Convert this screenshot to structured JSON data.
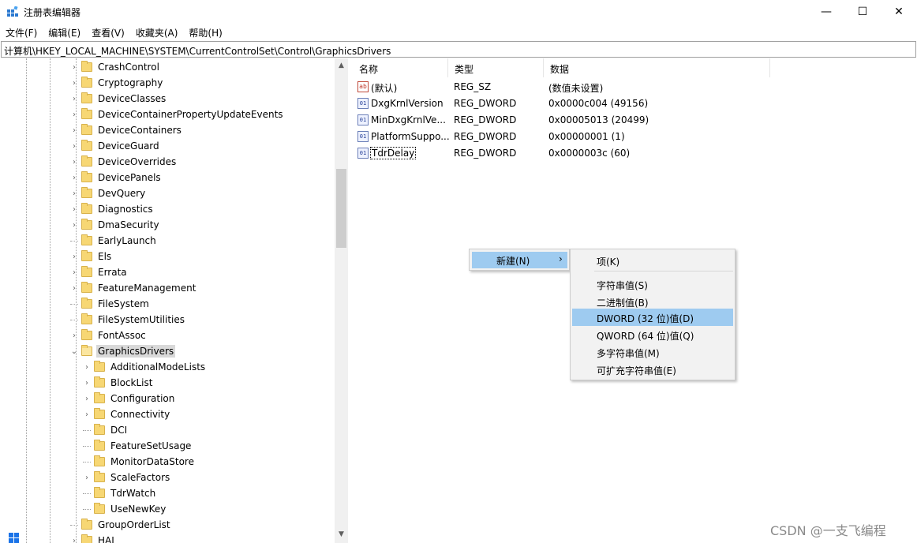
{
  "window": {
    "title": "注册表编辑器",
    "minimize": "—",
    "maximize": "☐",
    "close": "✕"
  },
  "menu": [
    "文件(F)",
    "编辑(E)",
    "查看(V)",
    "收藏夹(A)",
    "帮助(H)"
  ],
  "address": "计算机\\HKEY_LOCAL_MACHINE\\SYSTEM\\CurrentControlSet\\Control\\GraphicsDrivers",
  "tree": {
    "items": [
      {
        "label": "CrashControl",
        "expandable": true
      },
      {
        "label": "Cryptography",
        "expandable": true
      },
      {
        "label": "DeviceClasses",
        "expandable": true
      },
      {
        "label": "DeviceContainerPropertyUpdateEvents",
        "expandable": true
      },
      {
        "label": "DeviceContainers",
        "expandable": true
      },
      {
        "label": "DeviceGuard",
        "expandable": true
      },
      {
        "label": "DeviceOverrides",
        "expandable": true
      },
      {
        "label": "DevicePanels",
        "expandable": true
      },
      {
        "label": "DevQuery",
        "expandable": true
      },
      {
        "label": "Diagnostics",
        "expandable": true
      },
      {
        "label": "DmaSecurity",
        "expandable": true
      },
      {
        "label": "EarlyLaunch",
        "expandable": false
      },
      {
        "label": "Els",
        "expandable": true
      },
      {
        "label": "Errata",
        "expandable": true
      },
      {
        "label": "FeatureManagement",
        "expandable": true
      },
      {
        "label": "FileSystem",
        "expandable": false
      },
      {
        "label": "FileSystemUtilities",
        "expandable": false
      },
      {
        "label": "FontAssoc",
        "expandable": true
      },
      {
        "label": "GraphicsDrivers",
        "expandable": true,
        "expanded": true,
        "selected": true
      },
      {
        "label": "AdditionalModeLists",
        "expandable": true,
        "child": true
      },
      {
        "label": "BlockList",
        "expandable": true,
        "child": true
      },
      {
        "label": "Configuration",
        "expandable": true,
        "child": true
      },
      {
        "label": "Connectivity",
        "expandable": true,
        "child": true
      },
      {
        "label": "DCI",
        "expandable": false,
        "child": true
      },
      {
        "label": "FeatureSetUsage",
        "expandable": false,
        "child": true
      },
      {
        "label": "MonitorDataStore",
        "expandable": false,
        "child": true
      },
      {
        "label": "ScaleFactors",
        "expandable": true,
        "child": true
      },
      {
        "label": "TdrWatch",
        "expandable": false,
        "child": true
      },
      {
        "label": "UseNewKey",
        "expandable": false,
        "child": true
      },
      {
        "label": "GroupOrderList",
        "expandable": false
      },
      {
        "label": "HAL",
        "expandable": true
      }
    ]
  },
  "columns": {
    "name": "名称",
    "type": "类型",
    "data": "数据"
  },
  "values": [
    {
      "icon": "ab",
      "name": "(默认)",
      "type": "REG_SZ",
      "data": "(数值未设置)"
    },
    {
      "icon": "bin",
      "name": "DxgKrnlVersion",
      "type": "REG_DWORD",
      "data": "0x0000c004 (49156)"
    },
    {
      "icon": "bin",
      "name": "MinDxgKrnlVe...",
      "type": "REG_DWORD",
      "data": "0x00005013 (20499)"
    },
    {
      "icon": "bin",
      "name": "PlatformSuppo...",
      "type": "REG_DWORD",
      "data": "0x00000001 (1)"
    },
    {
      "icon": "bin",
      "name": "TdrDelay",
      "type": "REG_DWORD",
      "data": "0x0000003c (60)",
      "focused": true
    }
  ],
  "context_menu": {
    "new_label": "新建(N)",
    "arrow": "›",
    "submenu": [
      {
        "label": "项(K)"
      },
      {
        "label": "字符串值(S)"
      },
      {
        "label": "二进制值(B)"
      },
      {
        "label": "DWORD (32 位)值(D)",
        "hover": true
      },
      {
        "label": "QWORD (64 位)值(Q)"
      },
      {
        "label": "多字符串值(M)"
      },
      {
        "label": "可扩充字符串值(E)"
      }
    ]
  },
  "watermark": "CSDN @一支飞编程"
}
